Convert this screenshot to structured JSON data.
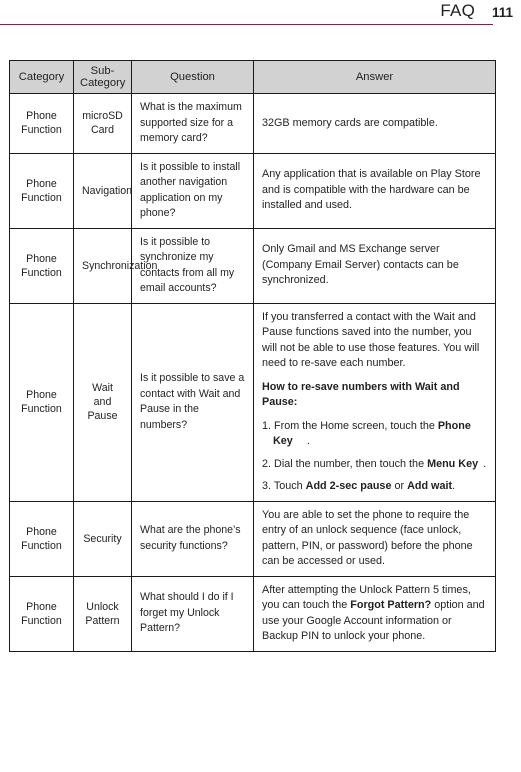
{
  "header": {
    "title": "FAQ",
    "page_number": "111",
    "rule_color": "#b4054c"
  },
  "table": {
    "columns": [
      "Category",
      "Sub-Category",
      "Question",
      "Answer"
    ],
    "header_bg": "#d2d2d2",
    "rows": [
      {
        "category": "Phone Function",
        "sub_category": "microSD Card",
        "question": "What is the maximum supported size for a memory card?",
        "answer_text": "32GB memory cards are compatible."
      },
      {
        "category": "Phone Function",
        "sub_category": "Navigation",
        "question": "Is it possible to install another navigation application on my phone?",
        "answer_text": "Any application that is available on Play Store and is compatible with the hardware can be installed and used."
      },
      {
        "category": "Phone Function",
        "sub_category": "Synchronization",
        "question": "Is it possible to synchronize my contacts from all my email accounts?",
        "answer_text": "Only Gmail and MS Exchange server (Company Email Server) contacts can be synchronized."
      },
      {
        "category": "Phone Function",
        "sub_category": "Wait and Pause",
        "question": "Is it possible to save a contact with Wait and Pause in the numbers?",
        "answer_lead": "If you transferred a contact with the Wait and Pause functions saved into the number, you will not be able to use those features. You will need to re-save each number.",
        "answer_subhead": "How to re-save numbers with Wait and Pause:",
        "steps": [
          {
            "number": "1.",
            "text_before": "From the Home screen, touch the",
            "bold_label": "Phone Key",
            "icon": "phone-key-icon",
            "text_after": "."
          },
          {
            "number": "2.",
            "text_before": "Dial the number, then touch the",
            "bold_label": "Menu Key",
            "icon": "menu-key-icon",
            "text_after": "."
          },
          {
            "number": "3.",
            "text_before": "Touch",
            "bold_a": "Add 2-sec pause",
            "mid": "or",
            "bold_b": "Add wait",
            "text_after": "."
          }
        ]
      },
      {
        "category": "Phone Function",
        "sub_category": "Security",
        "question": "What are the phone’s security functions?",
        "answer_text": "You are able to set the phone to require the entry of an unlock sequence (face unlock, pattern, PIN, or password) before the phone can be accessed or used."
      },
      {
        "category": "Phone Function",
        "sub_category": "Unlock Pattern",
        "question": "What should I do if I forget my Unlock Pattern?",
        "answer_parts": {
          "a": "After attempting the Unlock Pattern 5 times, you can touch the ",
          "bold": "Forgot Pattern?",
          "b": " option and use your Google Account information or Backup PIN to unlock your phone."
        }
      }
    ]
  },
  "icons": {
    "phone_key_color": "#3fae29",
    "menu_key_color": "#2f2f2f"
  }
}
